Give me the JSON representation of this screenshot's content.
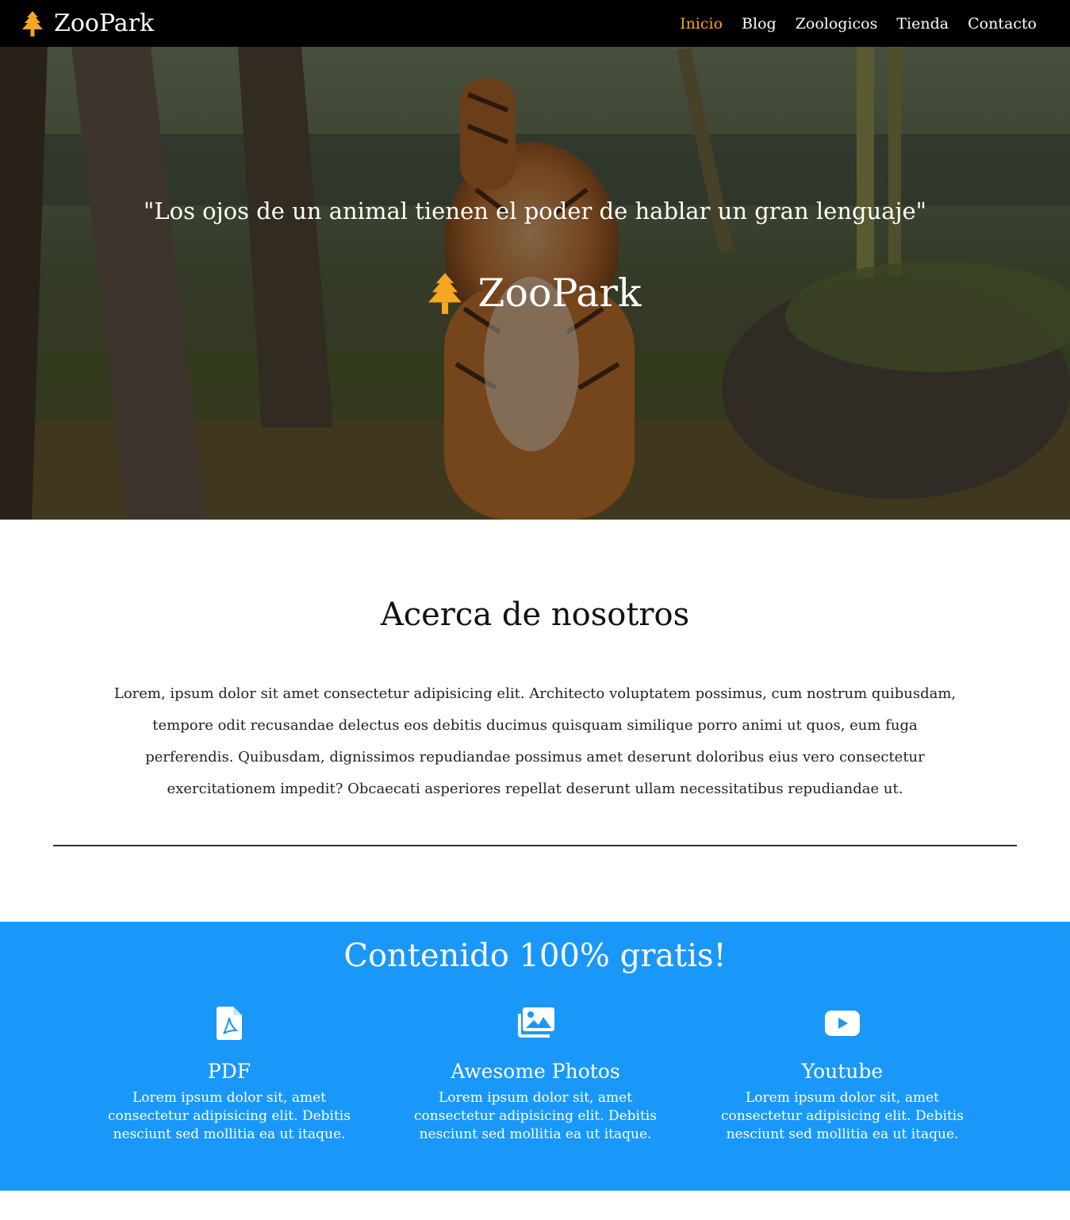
{
  "navbar": {
    "brand_icon": "tree-icon",
    "brand": "ZooPark",
    "links": [
      "Inicio",
      "Blog",
      "Zoologicos",
      "Tienda",
      "Contacto"
    ],
    "active_link": "Inicio"
  },
  "hero": {
    "quote": "\"Los ojos de un animal tienen el poder de hablar un gran lenguaje\"",
    "brand_icon": "tree-icon",
    "brand": "ZooPark"
  },
  "about": {
    "title": "Acerca de nosotros",
    "text": "Lorem, ipsum dolor sit amet consectetur adipisicing elit. Architecto voluptatem possimus, cum nostrum quibusdam, tempore odit recusandae delectus eos debitis ducimus quisquam similique porro animi ut quos, eum fuga perferendis. Quibusdam, dignissimos repudiandae possimus amet deserunt doloribus eius vero consectetur exercitationem impedit? Obcaecati asperiores repellat deserunt ullam necessitatibus repudiandae ut."
  },
  "free": {
    "title": "Contenido 100% gratis!",
    "features": [
      {
        "icon": "pdf-file-icon",
        "title": "PDF",
        "text": "Lorem ipsum dolor sit, amet consectetur adipisicing elit. Debitis nesciunt sed mollitia ea ut itaque."
      },
      {
        "icon": "images-icon",
        "title": "Awesome Photos",
        "text": "Lorem ipsum dolor sit, amet consectetur adipisicing elit. Debitis nesciunt sed mollitia ea ut itaque."
      },
      {
        "icon": "youtube-icon",
        "title": "Youtube",
        "text": "Lorem ipsum dolor sit, amet consectetur adipisicing elit. Debitis nesciunt sed mollitia ea ut itaque."
      }
    ]
  },
  "colors": {
    "navbar_bg": "#000000",
    "accent": "#f5a623",
    "free_bg": "#1a98fa"
  }
}
